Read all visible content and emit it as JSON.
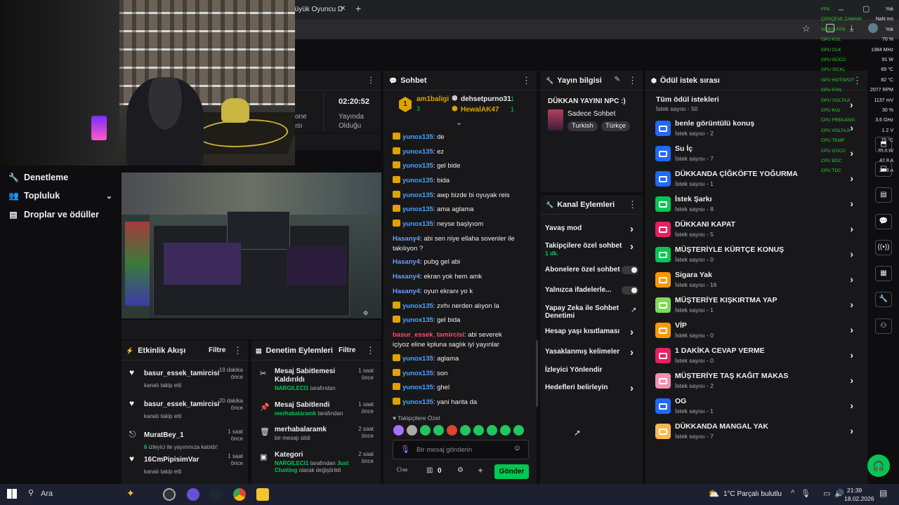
{
  "browser": {
    "tab_title": "Büyük Oyuncu D",
    "new_tab": "+",
    "close_tab": "✕"
  },
  "nav": {
    "items": [
      {
        "label": "Denetleme"
      },
      {
        "label": "Topluluk"
      },
      {
        "label": "Droplar ve ödüller"
      }
    ]
  },
  "stream_panel": {
    "time": "02:20:52",
    "time_label_1": "Yayında",
    "time_label_2": "Olduğu",
    "partial_1": "one",
    "partial_2": "ısı"
  },
  "chat": {
    "title": "Sohbet",
    "leaders": [
      {
        "rank": "1",
        "name": "am1baligi",
        "count": "3"
      },
      {
        "name": "dehsetpurno31",
        "count": "1"
      },
      {
        "name": "HewalAK47",
        "count": "1"
      }
    ],
    "messages": [
      {
        "user": "yunox135",
        "text": ": de",
        "badge": true,
        "cls": "u1"
      },
      {
        "user": "yunox135",
        "text": ": ez",
        "badge": true,
        "cls": "u1"
      },
      {
        "user": "yunox135",
        "text": ": gel bide",
        "badge": true,
        "cls": "u1"
      },
      {
        "user": "yunox135",
        "text": ": bida",
        "badge": true,
        "cls": "u1"
      },
      {
        "user": "yunox135",
        "text": ": awp bizde bi oyuyak reis",
        "badge": true,
        "cls": "u1"
      },
      {
        "user": "yunox135",
        "text": ": ama aglama",
        "badge": true,
        "cls": "u1"
      },
      {
        "user": "yunox135",
        "text": ": neyse başlyıom",
        "badge": true,
        "cls": "u1"
      },
      {
        "user": "Hasany4",
        "text": ": abi sen niye ellaha sovenler ile takılıyon ?",
        "badge": false,
        "cls": "u2"
      },
      {
        "user": "Hasany4",
        "text": ": pubg gel abi",
        "badge": false,
        "cls": "u2"
      },
      {
        "user": "Hasany4",
        "text": ": ekran yok hem amk",
        "badge": false,
        "cls": "u2"
      },
      {
        "user": "Hasany4",
        "text": ": oyun ekranı yo k",
        "badge": false,
        "cls": "u2"
      },
      {
        "user": "yunox135",
        "text": ": zırhı nerden alıyon la",
        "badge": true,
        "cls": "u1"
      },
      {
        "user": "yunox135",
        "text": ": gel bida",
        "badge": true,
        "cls": "u1"
      },
      {
        "user": "basur_essek_tamircisi",
        "text": ": abi severek içiyoz eline kpluna saglık iyi yayınlar",
        "badge": false,
        "cls": "u3"
      },
      {
        "user": "yunox135",
        "text": ": aglama",
        "badge": true,
        "cls": "u1"
      },
      {
        "user": "yunox135",
        "text": ": son",
        "badge": true,
        "cls": "u1"
      },
      {
        "user": "yunox135",
        "text": ": ghel",
        "badge": true,
        "cls": "u1"
      },
      {
        "user": "yunox135",
        "text": ": yani harita da",
        "badge": true,
        "cls": "u1"
      }
    ],
    "followers_only": "Takipçilere Özel",
    "input_placeholder": "Bir mesaj gönderin",
    "points": "0",
    "send": "Gönder"
  },
  "stream_info": {
    "title": "Yayın bilgisi",
    "stream_title": "DÜKKAN YAYINI NPC :)",
    "category": "Sadece Sohbet",
    "tags": [
      "Turkish",
      "Türkçe"
    ]
  },
  "channel_actions": {
    "title": "Kanal Eylemleri",
    "items": [
      {
        "label": "Yavaş mod",
        "sub": "",
        "ctrl": "chevron"
      },
      {
        "label": "Takipçilere özel sohbet",
        "sub": "1 dk.",
        "ctrl": "chevron"
      },
      {
        "label": "Abonelere özel sohbet",
        "sub": "",
        "ctrl": "toggle"
      },
      {
        "label": "Yalnızca ifadelerle...",
        "sub": "",
        "ctrl": "toggle"
      },
      {
        "label": "Yapay Zeka ile Sohbet Denetimi",
        "sub": "",
        "ctrl": "external"
      },
      {
        "label": "Hesap yaşı kısıtlaması",
        "sub": "",
        "ctrl": "chevron"
      },
      {
        "label": "Yasaklanmış kelimeler",
        "sub": "",
        "ctrl": "chevron"
      },
      {
        "label": "İzleyici Yönlendir",
        "sub": "",
        "ctrl": "none"
      },
      {
        "label": "Hedefleri belirleyin",
        "sub": "",
        "ctrl": "chevron"
      }
    ]
  },
  "rewards": {
    "title": "Ödül istek sırası",
    "all_title": "Tüm ödül istekleri",
    "all_sub": "İstek sayısı - 50",
    "items": [
      {
        "name": "benle görüntülü konuş",
        "count": "İstek sayısı - 2",
        "color": "#1f69ff"
      },
      {
        "name": "Su İç",
        "count": "İstek sayısı - 7",
        "color": "#1f69ff"
      },
      {
        "name": "DÜKKANDA ÇİĞKÖFTE YOĞURMA",
        "count": "İstek sayısı - 1",
        "color": "#1f69ff"
      },
      {
        "name": "İstek Şarkı",
        "count": "İstek sayısı - 8",
        "color": "#00c853"
      },
      {
        "name": "DÜKKANI KAPAT",
        "count": "İstek sayısı - 5",
        "color": "#e91e63"
      },
      {
        "name": "MÜŞTERİYLE KÜRTÇE KONUŞ",
        "count": "İstek sayısı - 0",
        "color": "#00c853"
      },
      {
        "name": "Sigara Yak",
        "count": "İstek sayısı - 16",
        "color": "#ff9800"
      },
      {
        "name": "MÜŞTERİYE KIŞKIRTMA YAP",
        "count": "İstek sayısı - 1",
        "color": "#7ed957"
      },
      {
        "name": "VİP",
        "count": "İstek sayısı - 0",
        "color": "#ff9800"
      },
      {
        "name": "1 DAKİKA CEVAP VERME",
        "count": "İstek sayısı - 0",
        "color": "#e91e63"
      },
      {
        "name": "MÜŞTERİYE TAŞ KAĞIT MAKAS",
        "count": "İstek sayısı - 2",
        "color": "#f48fb1"
      },
      {
        "name": "OG",
        "count": "İstek sayısı - 1",
        "color": "#1f69ff"
      },
      {
        "name": "DÜKKANDA MANGAL YAK",
        "count": "İstek sayısı - 7",
        "color": "#ffb74d"
      }
    ]
  },
  "activity": {
    "title": "Etkinlik Akışı",
    "filter": "Filtre",
    "items": [
      {
        "user": "basur_essek_tamircisi",
        "sub": "kanalı takip etti",
        "time": "19 dakika önce"
      },
      {
        "user": "basur_essek_tamircisi",
        "sub": "kanalı takip etti",
        "time": "20 dakika önce"
      },
      {
        "user": "MuratBey_1",
        "sub_n": "6",
        "sub": " izleyici ile yayınınıza katıldı!",
        "time": "1 saat önce"
      },
      {
        "user": "16CmPipisimVar",
        "sub": "kanalı takip etti",
        "time": "1 saat önce"
      }
    ]
  },
  "mod_actions": {
    "title": "Denetim Eylemleri",
    "filter": "Filtre",
    "items": [
      {
        "title": "Mesaj Sabitlemesi Kaldırıldı",
        "who": "NARGILECI1",
        "rest": " tarafından",
        "extra": "",
        "time": "1 saat önce"
      },
      {
        "title": "Mesaj Sabitlendi",
        "who": "merhabalaramk",
        "rest": " tarafından",
        "extra": "",
        "time": "1 saat önce"
      },
      {
        "title": "merhabalaramk",
        "who": "",
        "rest": "bir mesajı sildi",
        "extra": "",
        "time": "2 saat önce"
      },
      {
        "title": "Kategori",
        "who": "NARGILECI1",
        "rest": " tarafından ",
        "extra": "Just Chatting",
        "extra2": " olarak değiştirildi",
        "time": "2 saat önce"
      }
    ]
  },
  "overlay": {
    "labels": [
      "FPS",
      "ÇERÇEVE ZAMANI",
      "VİDEO FPS",
      "GPU KUL",
      "GPU CLK",
      "GPU GÜCÜ",
      "GPU SICKL",
      "GPU HOTSPOT",
      "GPU FAN",
      "GPU VOLTAJI",
      "CPU KUL",
      "CPU FREKANSI",
      "CPU VOLTAJI",
      "CPU TEMP",
      "CPU GÜCÜ",
      "CPU EDC",
      "CPU TDC"
    ],
    "values": [
      "Yok",
      "NaN ms",
      "Yok",
      "70 %",
      "1384 MHz",
      "91 W",
      "69 °C",
      "82 °C",
      "2077 RPM",
      "1137 mV",
      "30 %",
      "3.6 GHz",
      "1.2 V",
      "75 °C",
      "35.0 W",
      "42.8 A",
      "29.8 A"
    ]
  },
  "taskbar": {
    "search": "Ara",
    "weather": "1°C  Parçalı bulutlu",
    "time": "21:39",
    "date": "18.02.2026"
  }
}
